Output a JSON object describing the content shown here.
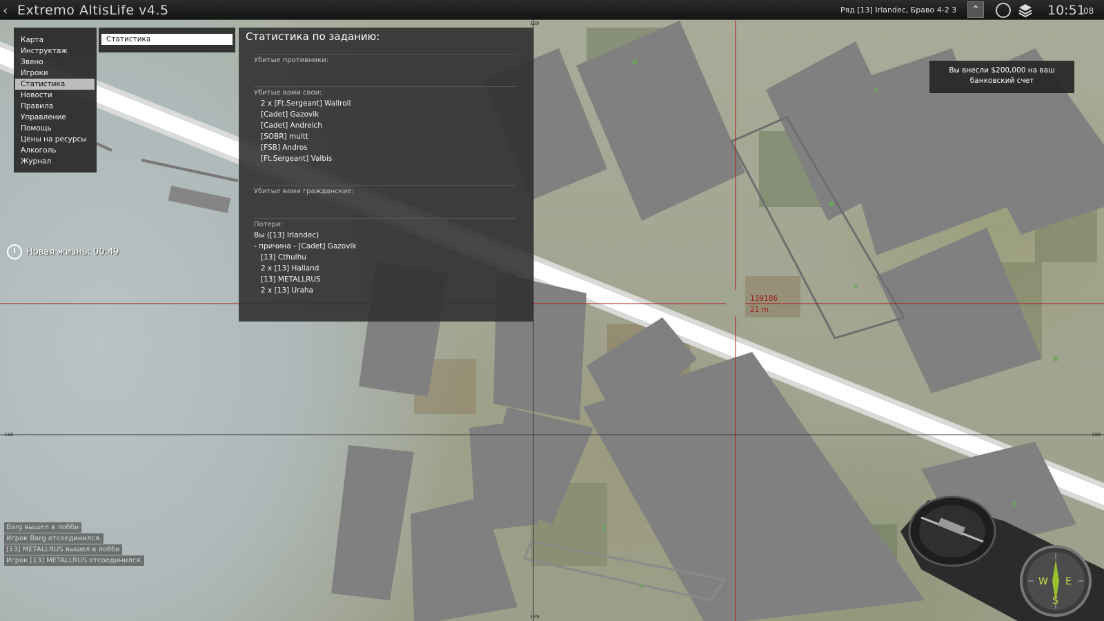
{
  "header": {
    "title": "Extremo AltisLife v4.5",
    "unit_info": "Ряд [13] Irlandec, Браво 4-2 3",
    "clock_main": "10:51",
    "clock_seconds": "08"
  },
  "menu": {
    "items": [
      {
        "label": "Карта"
      },
      {
        "label": "Инструктаж"
      },
      {
        "label": "Звено"
      },
      {
        "label": "Игроки"
      },
      {
        "label": "Статистика",
        "active": true
      },
      {
        "label": "Новости"
      },
      {
        "label": "Правила"
      },
      {
        "label": "Управление"
      },
      {
        "label": "Помощь"
      },
      {
        "label": "Цены на ресурсы"
      },
      {
        "label": "Алкоголь"
      },
      {
        "label": "Журнал"
      }
    ]
  },
  "tab": {
    "label": "Статистика"
  },
  "stats": {
    "title": "Статистика по заданию:",
    "enemies_heading": "Убитые противники:",
    "friendly_heading": "Убитые вами свои:",
    "friendly_kills": [
      "2 x [Ft.Sergeant] Wallroll",
      "[Cadet] Gazovik",
      "[Cadet] Andreich",
      "[SOBR] multt",
      "[FSB] Andros",
      "[Ft.Sergeant] Valbis"
    ],
    "civilian_heading": "Убитые вами гражданские:",
    "losses_heading": "Потери:",
    "losses_lines": [
      "Вы ([13] Irlandec)",
      "- причина - [Cadet] Gazovik",
      "[13] Cthulhu",
      "2 x [13] Halland",
      "[13] METALLRUS",
      "2 x [13] Uraha"
    ]
  },
  "respawn": {
    "text": "Новая жизнь: 00:49"
  },
  "notification": {
    "text_line1": "Вы внесли $200,000 на ваш",
    "text_line2": "банковский счет"
  },
  "chat": [
    "Barg вышел в лобби",
    "Игрок Barg отсоединился.",
    "[13] METALLRUS вышел в лобби",
    "Игрок [13] METALLRUS отсоединился."
  ],
  "map": {
    "cursor_coords": "139186",
    "cursor_distance": "21 m",
    "grid_label_top": "139",
    "grid_label_bottom": "139",
    "grid_label_left": "186",
    "grid_label_right": "186"
  },
  "compass": {
    "labels": [
      "W",
      "E",
      "S"
    ]
  },
  "colors": {
    "cursor_line": "#b01818",
    "panel_bg": "#2d2d2d",
    "menu_active": "#bdbdbd"
  }
}
